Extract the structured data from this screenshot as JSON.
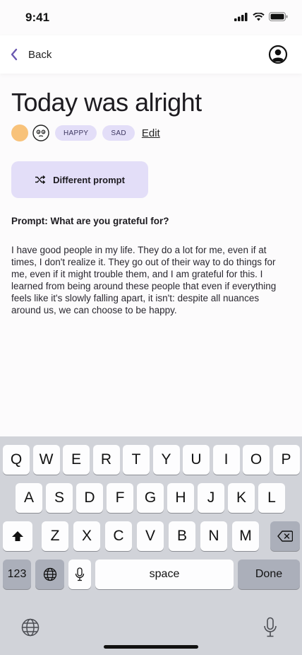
{
  "status_bar": {
    "time": "9:41"
  },
  "nav": {
    "back_label": "Back"
  },
  "entry": {
    "title": "Today was alright",
    "moods": [
      "HAPPY",
      "SAD"
    ],
    "edit_label": "Edit",
    "prompt_button_label": "Different prompt",
    "prompt": "Prompt: What are you grateful for?",
    "body": "I have good people in my life. They do a lot for me, even if at times, I don't realize it. They go out of their way to do things for me, even if it might trouble them, and I am grateful for this. I learned from being around these people that even if everything feels like it's slowly falling apart, it isn't: despite all nuances around us, we can choose to be happy."
  },
  "keyboard": {
    "row1": [
      "Q",
      "W",
      "E",
      "R",
      "T",
      "Y",
      "U",
      "I",
      "O",
      "P"
    ],
    "row2": [
      "A",
      "S",
      "D",
      "F",
      "G",
      "H",
      "J",
      "K",
      "L"
    ],
    "row3": [
      "Z",
      "X",
      "C",
      "V",
      "B",
      "N",
      "M"
    ],
    "numbers_label": "123",
    "space_label": "space",
    "done_label": "Done"
  },
  "colors": {
    "accent": "#e3def8",
    "mood_happy": "#f8c27a",
    "back_arrow": "#6a58b0"
  },
  "icons": [
    "signal-icon",
    "wifi-icon",
    "battery-icon",
    "back-chevron-icon",
    "profile-icon",
    "neutral-face-icon",
    "shuffle-icon",
    "shift-icon",
    "backspace-icon",
    "globe-icon",
    "mic-icon"
  ]
}
